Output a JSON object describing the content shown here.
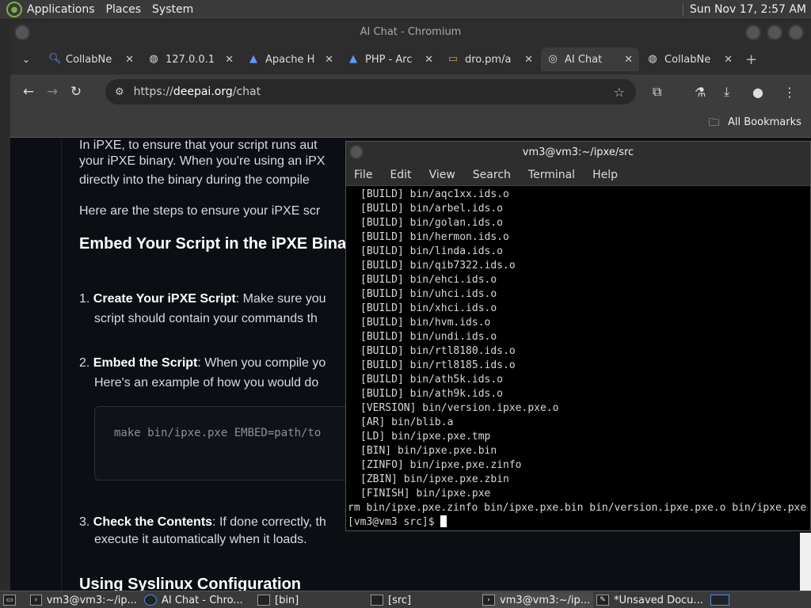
{
  "top_panel": {
    "menus": [
      "Applications",
      "Places",
      "System"
    ],
    "clock": "Sun Nov 17,  2:57 AM"
  },
  "chrome": {
    "title": "AI Chat - Chromium",
    "tabs": [
      {
        "label": "CollabNe",
        "icon": "search-icon"
      },
      {
        "label": "127.0.0.1",
        "icon": "globe-icon"
      },
      {
        "label": "Apache H",
        "icon": "apache-feather-icon"
      },
      {
        "label": "PHP - Arc",
        "icon": "apache-feather-icon"
      },
      {
        "label": "dro.pm/a",
        "icon": "image-icon"
      },
      {
        "label": "AI Chat",
        "icon": "ai-chat-icon",
        "active": true
      },
      {
        "label": "CollabNe",
        "icon": "globe-icon"
      }
    ],
    "url_scheme": "https://",
    "url_host": "deepai.org",
    "url_path": "/chat",
    "bookmarks_label": "All Bookmarks"
  },
  "page": {
    "intro_line1": "In iPXE, to ensure that your script runs aut",
    "intro_line2": "your iPXE binary. When you're using an iPX",
    "intro_line3": "directly into the binary during the compile",
    "steps_line": "Here are the steps to ensure your iPXE scr",
    "heading1": "Embed Your Script in the iPXE Binar",
    "step1_num": "1.",
    "step1_bold": "Create Your iPXE Script",
    "step1_rest": ": Make sure you",
    "step1_line2": "script should contain your commands th",
    "step2_num": "2.",
    "step2_bold": "Embed the Script",
    "step2_rest": ": When you compile yo",
    "step2_line2": "Here's an example of how you would do",
    "code": "make bin/ipxe.pxe EMBED=path/to",
    "step3_num": "3.",
    "step3_bold": "Check the Contents",
    "step3_rest": ": If done correctly, th",
    "step3_line2": "execute it automatically when it loads.",
    "heading2": "Using Syslinux Configuration"
  },
  "terminal": {
    "title": "vm3@vm3:~/ipxe/src",
    "menus": [
      "File",
      "Edit",
      "View",
      "Search",
      "Terminal",
      "Help"
    ],
    "lines": [
      "[BUILD] bin/aqc1xx.ids.o",
      "[BUILD] bin/arbel.ids.o",
      "[BUILD] bin/golan.ids.o",
      "[BUILD] bin/hermon.ids.o",
      "[BUILD] bin/linda.ids.o",
      "[BUILD] bin/qib7322.ids.o",
      "[BUILD] bin/ehci.ids.o",
      "[BUILD] bin/uhci.ids.o",
      "[BUILD] bin/xhci.ids.o",
      "[BUILD] bin/hvm.ids.o",
      "[BUILD] bin/undi.ids.o",
      "[BUILD] bin/rtl8180.ids.o",
      "[BUILD] bin/rtl8185.ids.o",
      "[BUILD] bin/ath5k.ids.o",
      "[BUILD] bin/ath9k.ids.o",
      "[VERSION] bin/version.ipxe.pxe.o",
      "[AR] bin/blib.a",
      "[LD] bin/ipxe.pxe.tmp",
      "[BIN] bin/ipxe.pxe.bin",
      "[ZINFO] bin/ipxe.pxe.zinfo",
      "[ZBIN] bin/ipxe.pxe.zbin",
      "[FINISH] bin/ipxe.pxe"
    ],
    "rm_line": "rm bin/ipxe.pxe.zinfo bin/ipxe.pxe.bin bin/version.ipxe.pxe.o bin/ipxe.pxe",
    "prompt": "[vm3@vm3 src]$ "
  },
  "taskbar": {
    "items": [
      "vm3@vm3:~/ip...",
      "AI Chat - Chro...",
      "[bin]",
      "[src]",
      "vm3@vm3:~/ip...",
      "*Unsaved Docu..."
    ]
  }
}
